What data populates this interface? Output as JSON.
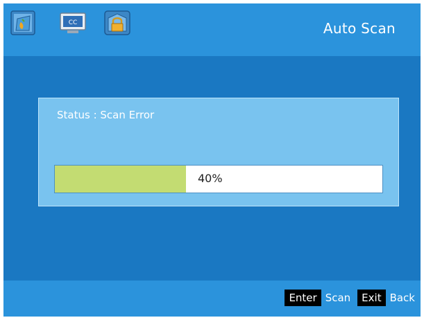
{
  "header": {
    "icons": [
      {
        "name": "picture-icon"
      },
      {
        "name": "closed-caption-icon",
        "text": "CC"
      },
      {
        "name": "lock-icon"
      }
    ],
    "title": "Auto Scan"
  },
  "dialog": {
    "status_text": "Status : Scan Error",
    "progress": {
      "percent": 40,
      "label": "40%"
    }
  },
  "footer": {
    "hints": [
      {
        "key": "Enter",
        "label": "Scan"
      },
      {
        "key": "Exit",
        "label": "Back"
      }
    ]
  },
  "colors": {
    "background": "#1a78c2",
    "bar": "#2b93dc",
    "dialog": "#79c3ef",
    "progress_fill": "#c3dc72"
  }
}
